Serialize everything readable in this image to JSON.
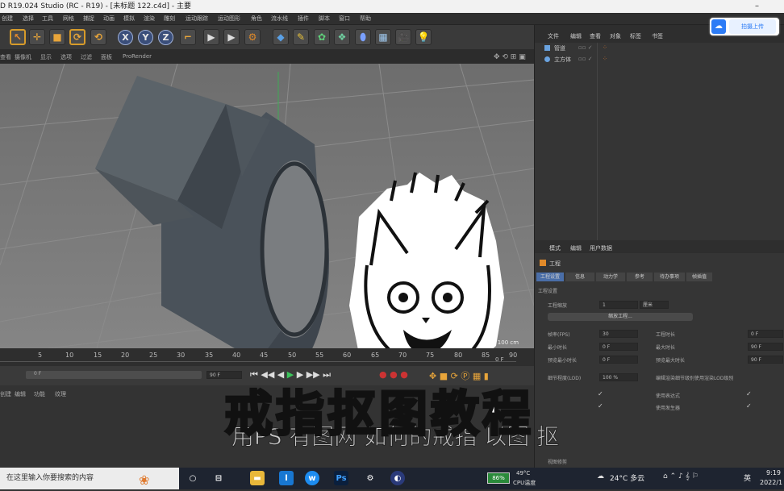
{
  "window": {
    "title": "D R19.024 Studio (RC - R19) - [未标题 122.c4d] - 主要",
    "minimize": "–"
  },
  "menu": [
    "创建",
    "选择",
    "工具",
    "网格",
    "捕捉",
    "动画",
    "模拟",
    "渲染",
    "雕刻",
    "运动跟踪",
    "运动图形",
    "角色",
    "流水线",
    "插件",
    "脚本",
    "窗口",
    "帮助"
  ],
  "toolbar": {
    "axis_x": "X",
    "axis_y": "Y",
    "axis_z": "Z"
  },
  "viewport": {
    "menu": [
      "查看",
      "摄像机",
      "显示",
      "选项",
      "过滤",
      "面板",
      "ProRender"
    ],
    "grid_spacing": "网格间距 : 100 cm"
  },
  "timeline": {
    "ticks": [
      "5",
      "10",
      "15",
      "20",
      "25",
      "30",
      "35",
      "40",
      "45",
      "50",
      "55",
      "60",
      "65",
      "70",
      "75",
      "80",
      "85",
      "90"
    ],
    "frame_right": "0 F"
  },
  "playback": {
    "start": "0 F",
    "end": "90 F"
  },
  "material_tabs": [
    "创建",
    "编辑",
    "功能",
    "纹理"
  ],
  "object_manager": {
    "menu": [
      "文件",
      "编辑",
      "查看",
      "对象",
      "标签",
      "书签"
    ],
    "objects": [
      "管道",
      "立方体"
    ]
  },
  "attribute_manager": {
    "menu": [
      "模式",
      "编辑",
      "用户数据"
    ],
    "title": "工程",
    "tabs": [
      "工程设置",
      "信息",
      "动力学",
      "参考",
      "待办事项",
      "帧插值"
    ],
    "section": "工程设置",
    "scale_label": "工程缩放",
    "scale_value": "1",
    "scale_unit": "厘米",
    "scale_button": "缩放工程...",
    "fields": [
      {
        "label": "帧率(FPS)",
        "value": "30"
      },
      {
        "label": "最小时长",
        "value": "0 F"
      },
      {
        "label": "预览最小时长",
        "value": "0 F"
      },
      {
        "label": "细节程度(LOD)",
        "value": "100 %"
      }
    ],
    "fields_right": [
      {
        "label": "工程时长",
        "value": "0 F"
      },
      {
        "label": "最大时长",
        "value": "90 F"
      },
      {
        "label": "预览最大时长",
        "value": "90 F"
      }
    ],
    "lod_label": "编辑渲染细节级别使用渲染LOD级别",
    "checks_right": [
      "使用表达式",
      "使用发生器"
    ],
    "bottom_label": "视图修剪"
  },
  "upload_button": "拍摄上传",
  "overlay": {
    "title": "戒指抠图教程",
    "subtitle": "用PS 有图网 如何的戒指 以图 抠"
  },
  "taskbar": {
    "search_placeholder": "在这里输入你要搜索的内容",
    "cpu_temp": "49°C",
    "cpu_label": "CPU温度",
    "cpu_percent": "86%",
    "weather": "24°C 多云",
    "ime": "英",
    "time": "9:19",
    "date": "2022/1"
  }
}
